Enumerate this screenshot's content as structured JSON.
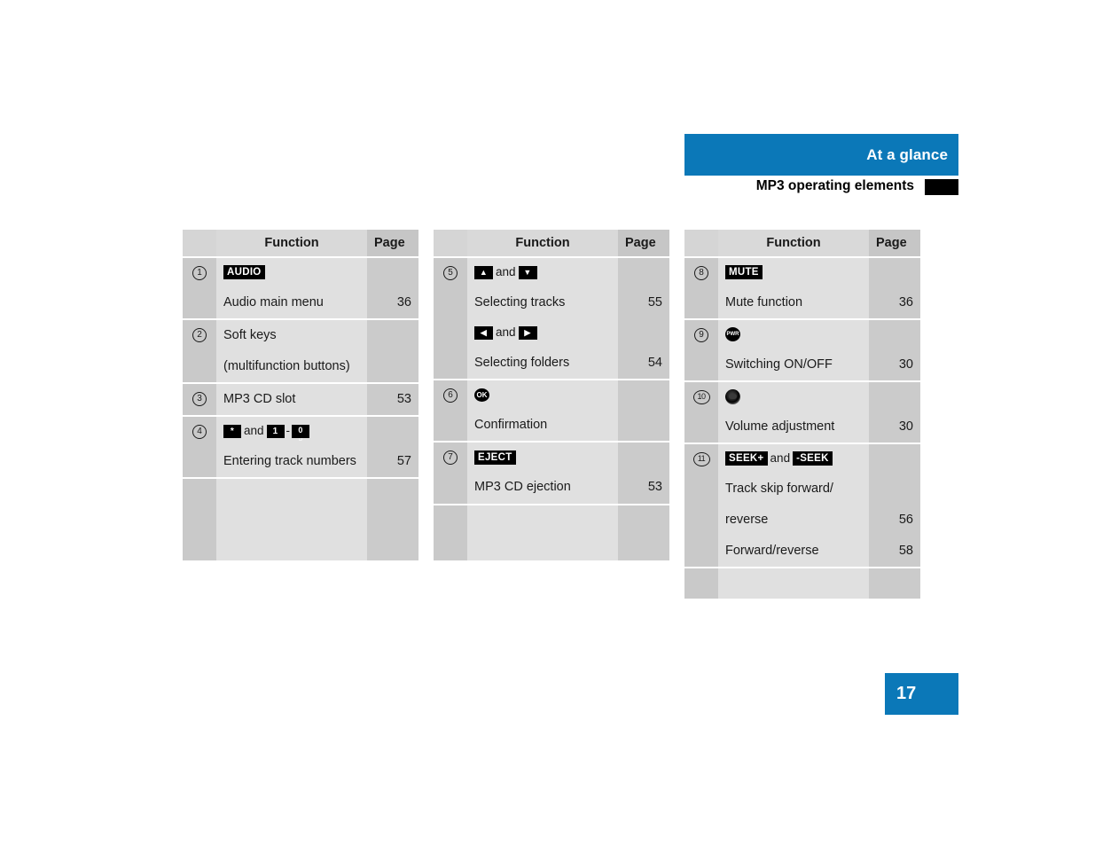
{
  "header": {
    "section_title": "At a glance",
    "page_title": "MP3 operating elements",
    "accent_color": "#0b78b8",
    "tab_marker_color": "#000000"
  },
  "page_badge": {
    "number": "17"
  },
  "tables": [
    {
      "id": "table-left",
      "columns": {
        "number": "",
        "function": "Function",
        "page": "Page"
      },
      "rows": [
        {
          "number": "1",
          "lines": [
            {
              "type": "key",
              "keys": [
                {
                  "kind": "label",
                  "text": "AUDIO"
                }
              ]
            },
            {
              "type": "text",
              "text": "Audio main menu",
              "page": "36"
            }
          ]
        },
        {
          "number": "2",
          "lines": [
            {
              "type": "text",
              "text": "Soft keys",
              "page": ""
            },
            {
              "type": "text",
              "text": "(multifunction buttons)",
              "page": ""
            }
          ]
        },
        {
          "number": "3",
          "lines": [
            {
              "type": "text",
              "text": "MP3 CD slot",
              "page": "53"
            }
          ]
        },
        {
          "number": "4",
          "lines": [
            {
              "type": "key",
              "keys": [
                {
                  "kind": "numkey",
                  "text": "*"
                },
                {
                  "kind": "sep",
                  "text": "and"
                },
                {
                  "kind": "numkey",
                  "text": "1"
                },
                {
                  "kind": "dash",
                  "text": "-"
                },
                {
                  "kind": "numkey-zero",
                  "text": "0",
                  "sub": "␣"
                }
              ]
            },
            {
              "type": "text",
              "text": "Entering track numbers",
              "page": "57"
            }
          ]
        }
      ]
    },
    {
      "id": "table-middle",
      "columns": {
        "number": "",
        "function": "Function",
        "page": "Page"
      },
      "rows": [
        {
          "number": "5",
          "lines": [
            {
              "type": "key",
              "keys": [
                {
                  "kind": "arrow",
                  "text": "▲"
                },
                {
                  "kind": "sep",
                  "text": "and"
                },
                {
                  "kind": "arrow",
                  "text": "▼"
                }
              ]
            },
            {
              "type": "text",
              "text": "Selecting tracks",
              "page": "55"
            },
            {
              "type": "key",
              "keys": [
                {
                  "kind": "arrow",
                  "text": "◀"
                },
                {
                  "kind": "sep",
                  "text": "and"
                },
                {
                  "kind": "arrow",
                  "text": "▶"
                }
              ]
            },
            {
              "type": "text",
              "text": "Selecting folders",
              "page": "54"
            }
          ]
        },
        {
          "number": "6",
          "lines": [
            {
              "type": "key",
              "keys": [
                {
                  "kind": "ok",
                  "text": "OK"
                }
              ]
            },
            {
              "type": "text",
              "text": "Confirmation",
              "page": ""
            }
          ]
        },
        {
          "number": "7",
          "lines": [
            {
              "type": "key",
              "keys": [
                {
                  "kind": "label",
                  "text": "EJECT"
                }
              ]
            },
            {
              "type": "text",
              "text": "MP3 CD ejection",
              "page": "53"
            }
          ]
        }
      ]
    },
    {
      "id": "table-right",
      "columns": {
        "number": "",
        "function": "Function",
        "page": "Page"
      },
      "rows": [
        {
          "number": "8",
          "lines": [
            {
              "type": "key",
              "keys": [
                {
                  "kind": "label",
                  "text": "MUTE"
                }
              ]
            },
            {
              "type": "text",
              "text": "Mute function",
              "page": "36"
            }
          ]
        },
        {
          "number": "9",
          "lines": [
            {
              "type": "key",
              "keys": [
                {
                  "kind": "pwr",
                  "text": "PWR"
                }
              ]
            },
            {
              "type": "text",
              "text": "Switching ON/OFF",
              "page": "30"
            }
          ]
        },
        {
          "number": "10",
          "lines": [
            {
              "type": "key",
              "keys": [
                {
                  "kind": "knob",
                  "text": ""
                }
              ]
            },
            {
              "type": "text",
              "text": "Volume adjustment",
              "page": "30"
            }
          ]
        },
        {
          "number": "11",
          "lines": [
            {
              "type": "key",
              "keys": [
                {
                  "kind": "label",
                  "text": "SEEK+"
                },
                {
                  "kind": "sep",
                  "text": "and"
                },
                {
                  "kind": "label",
                  "text": "-SEEK"
                }
              ]
            },
            {
              "type": "text",
              "text": "Track skip forward/",
              "page": ""
            },
            {
              "type": "text",
              "text": "reverse",
              "page": "56"
            },
            {
              "type": "text",
              "text": "Forward/reverse",
              "page": "58"
            }
          ]
        }
      ]
    }
  ]
}
